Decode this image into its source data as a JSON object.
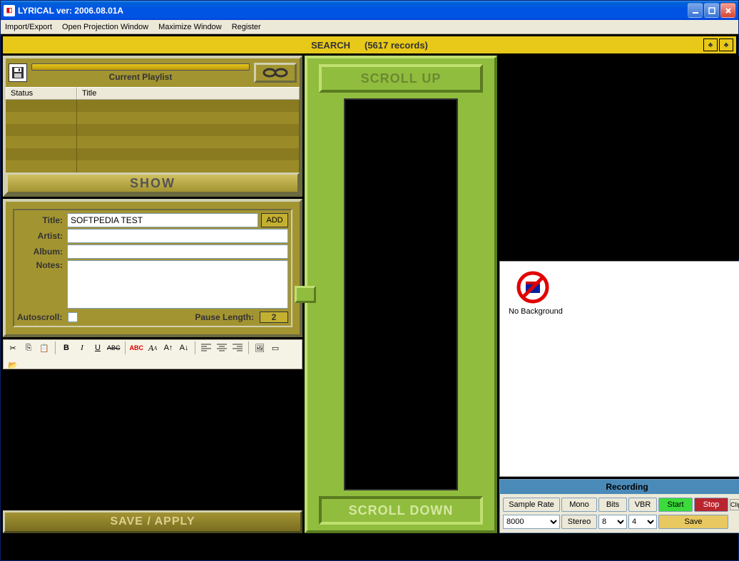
{
  "window": {
    "title": "LYRICAL    ver:  2006.08.01A"
  },
  "menu": {
    "import_export": "Import/Export",
    "open_projection": "Open Projection Window",
    "maximize": "Maximize Window",
    "register": "Register"
  },
  "search": {
    "label": "SEARCH",
    "records": "(5617 records)"
  },
  "playlist": {
    "title": "Current Playlist",
    "col_status": "Status",
    "col_title": "Title",
    "show_btn": "SHOW"
  },
  "meta": {
    "title_label": "Title:",
    "title_value": "SOFTPEDIA TEST",
    "add_btn": "ADD",
    "artist_label": "Artist:",
    "artist_value": "",
    "album_label": "Album:",
    "album_value": "",
    "notes_label": "Notes:",
    "notes_value": "",
    "autoscroll_label": "Autoscroll:",
    "pause_label": "Pause Length:",
    "pause_value": "2"
  },
  "toolbar": {
    "bold": "B",
    "italic": "I",
    "underline": "U",
    "strike": "ABC",
    "color": "ABC"
  },
  "save_apply": "SAVE / APPLY",
  "scroll": {
    "up": "SCROLL UP",
    "down": "SCROLL DOWN"
  },
  "background": {
    "no_bg": "No Background"
  },
  "recording": {
    "header": "Recording",
    "sample_rate": "Sample Rate",
    "mono": "Mono",
    "bits": "Bits",
    "vbr": "VBR",
    "start": "Start",
    "stop": "Stop",
    "clip": "Clip",
    "rate_value": "8000",
    "stereo": "Stereo",
    "bits_value": "8",
    "vbr_value": "4",
    "save": "Save"
  }
}
